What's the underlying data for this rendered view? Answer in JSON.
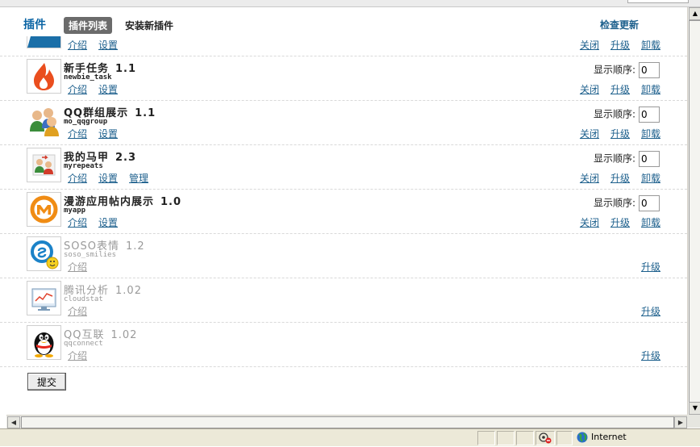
{
  "header": {
    "title": "插件",
    "tab_active": "插件列表",
    "tab_install": "安装新插件",
    "check_update": "检查更新"
  },
  "labels": {
    "intro": "介绍",
    "settings": "设置",
    "manage": "管理",
    "close": "关闭",
    "upgrade": "升级",
    "uninstall": "卸载",
    "display_order": "显示顺序:",
    "submit": "提交"
  },
  "plugins": [
    {
      "name": "新手任务",
      "version": "1.1",
      "id": "newbie_task",
      "order": "0",
      "icon": "flame-icon"
    },
    {
      "name": "QQ群组展示",
      "version": "1.1",
      "id": "mo_qqgroup",
      "order": "0",
      "icon": "group-users-icon"
    },
    {
      "name": "我的马甲",
      "version": "2.3",
      "id": "myrepeats",
      "order": "0",
      "icon": "user-swap-icon"
    },
    {
      "name": "漫游应用帖内展示",
      "version": "1.0",
      "id": "myapp",
      "order": "0",
      "icon": "manyou-m-icon"
    },
    {
      "name": "SOSO表情",
      "version": "1.2",
      "id": "soso_smilies",
      "icon": "soso-smiley-icon"
    },
    {
      "name": "腾讯分析",
      "version": "1.02",
      "id": "cloudstat",
      "icon": "analytics-chart-icon"
    },
    {
      "name": "QQ互联",
      "version": "1.02",
      "id": "qqconnect",
      "icon": "qq-penguin-icon"
    }
  ],
  "statusbar": {
    "zone": "Internet"
  }
}
